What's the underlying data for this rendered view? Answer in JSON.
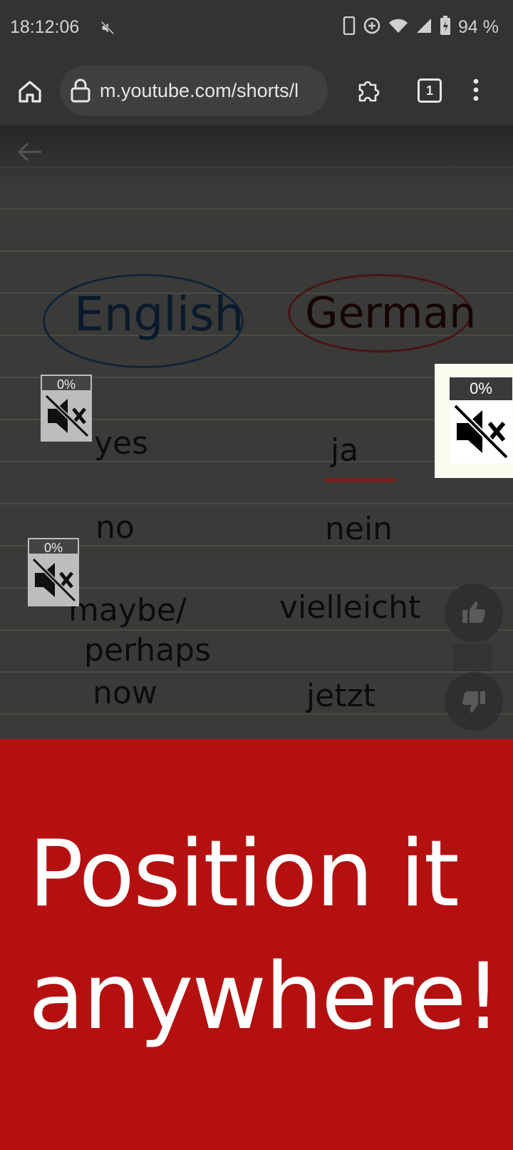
{
  "status_bar": {
    "time": "18:12:06",
    "battery": "94 %",
    "icons": [
      "mute-icon",
      "phone-icon",
      "data-saver-icon",
      "wifi-icon",
      "signal-icon",
      "battery-icon"
    ]
  },
  "browser": {
    "url": "m.youtube.com/shorts/l",
    "tab_count": "1"
  },
  "video": {
    "headers": {
      "english": "English",
      "german": "German"
    },
    "words": {
      "en": [
        "yes",
        "no",
        "maybe/",
        "perhaps",
        "now"
      ],
      "de": [
        "ja",
        "nein",
        "vielleicht",
        "jetzt"
      ]
    }
  },
  "badges": {
    "badge_1": "0%",
    "badge_2": "0%",
    "badge_3": "0%"
  },
  "promo": {
    "line1": "Position it",
    "line2": "anywhere!"
  },
  "colors": {
    "promo_bg": "#b51010",
    "bar_bg": "#333333"
  }
}
